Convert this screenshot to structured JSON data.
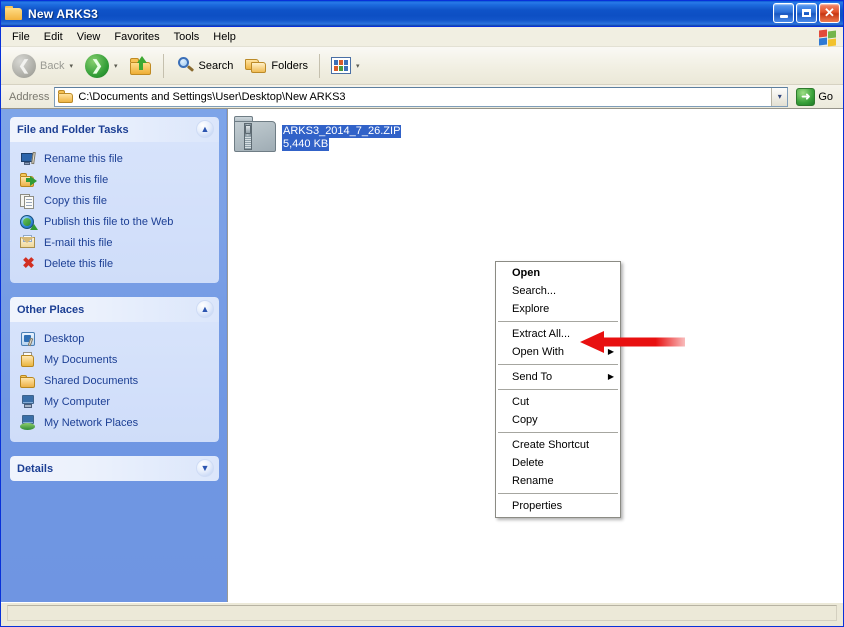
{
  "window": {
    "title": "New ARKS3",
    "title_icon": "folder-icon",
    "caption": {
      "minimize": "minimize-button",
      "maximize": "maximize-button",
      "close_glyph": "✕"
    }
  },
  "menubar": {
    "items": [
      {
        "label": "File"
      },
      {
        "label": "Edit"
      },
      {
        "label": "View"
      },
      {
        "label": "Favorites"
      },
      {
        "label": "Tools"
      },
      {
        "label": "Help"
      }
    ],
    "brand_icon": "windows-flag-icon"
  },
  "toolbar": {
    "back_label": "Back",
    "back_icon": "back-arrow-icon",
    "forward_icon": "forward-arrow-icon",
    "up_icon": "up-folder-icon",
    "search_label": "Search",
    "search_icon": "search-magnifier-icon",
    "folders_label": "Folders",
    "folders_icon": "folders-icon",
    "views_icon": "views-icon",
    "dropdown_glyph": "▾"
  },
  "address": {
    "label": "Address",
    "value": "C:\\Documents and Settings\\User\\Desktop\\New ARKS3",
    "folder_icon": "folder-icon",
    "dropdown_glyph": "▾",
    "go_label": "Go",
    "go_glyph": "➜"
  },
  "sidebar": {
    "panels": [
      {
        "title": "File and Folder Tasks",
        "collapse_glyph": "▲",
        "collapsed": false,
        "items": [
          {
            "label": "Rename this file",
            "icon": "rename-icon"
          },
          {
            "label": "Move this file",
            "icon": "move-icon"
          },
          {
            "label": "Copy this file",
            "icon": "copy-icon"
          },
          {
            "label": "Publish this file to the Web",
            "icon": "publish-web-icon"
          },
          {
            "label": "E-mail this file",
            "icon": "email-icon"
          },
          {
            "label": "Delete this file",
            "icon": "delete-x-icon"
          }
        ]
      },
      {
        "title": "Other Places",
        "collapse_glyph": "▲",
        "collapsed": false,
        "items": [
          {
            "label": "Desktop",
            "icon": "desktop-icon"
          },
          {
            "label": "My Documents",
            "icon": "my-documents-icon"
          },
          {
            "label": "Shared Documents",
            "icon": "shared-documents-icon"
          },
          {
            "label": "My Computer",
            "icon": "my-computer-icon"
          },
          {
            "label": "My Network Places",
            "icon": "my-network-places-icon"
          }
        ]
      },
      {
        "title": "Details",
        "collapse_glyph": "▼",
        "collapsed": true,
        "items": []
      }
    ]
  },
  "file_pane": {
    "selected_file": {
      "name": "ARKS3_2014_7_26.ZIP",
      "size": "5,440 KB",
      "icon": "zip-folder-icon",
      "selected": true
    }
  },
  "context_menu": {
    "groups": [
      [
        {
          "label": "Open",
          "bold": true,
          "submenu": false
        },
        {
          "label": "Search...",
          "bold": false,
          "submenu": false
        },
        {
          "label": "Explore",
          "bold": false,
          "submenu": false
        }
      ],
      [
        {
          "label": "Extract All...",
          "bold": false,
          "submenu": false
        },
        {
          "label": "Open With",
          "bold": false,
          "submenu": true
        }
      ],
      [
        {
          "label": "Send To",
          "bold": false,
          "submenu": true
        }
      ],
      [
        {
          "label": "Cut",
          "bold": false,
          "submenu": false
        },
        {
          "label": "Copy",
          "bold": false,
          "submenu": false
        }
      ],
      [
        {
          "label": "Create Shortcut",
          "bold": false,
          "submenu": false
        },
        {
          "label": "Delete",
          "bold": false,
          "submenu": false
        },
        {
          "label": "Rename",
          "bold": false,
          "submenu": false
        }
      ],
      [
        {
          "label": "Properties",
          "bold": false,
          "submenu": false
        }
      ]
    ],
    "submenu_glyph": "▶"
  },
  "annotation": {
    "type": "arrow",
    "color": "#e81010",
    "points_to": "Extract All...",
    "direction": "left"
  },
  "colors": {
    "titlebar_blue": "#0f53c8",
    "selection_blue": "#3162c8",
    "sidebar_blue": "#7ba0e6",
    "panel_body": "#d7e3fb",
    "link_blue": "#1c3f94",
    "chrome_tan": "#ece9d8",
    "annotation_red": "#e81010"
  },
  "statusbar": {
    "text": ""
  }
}
